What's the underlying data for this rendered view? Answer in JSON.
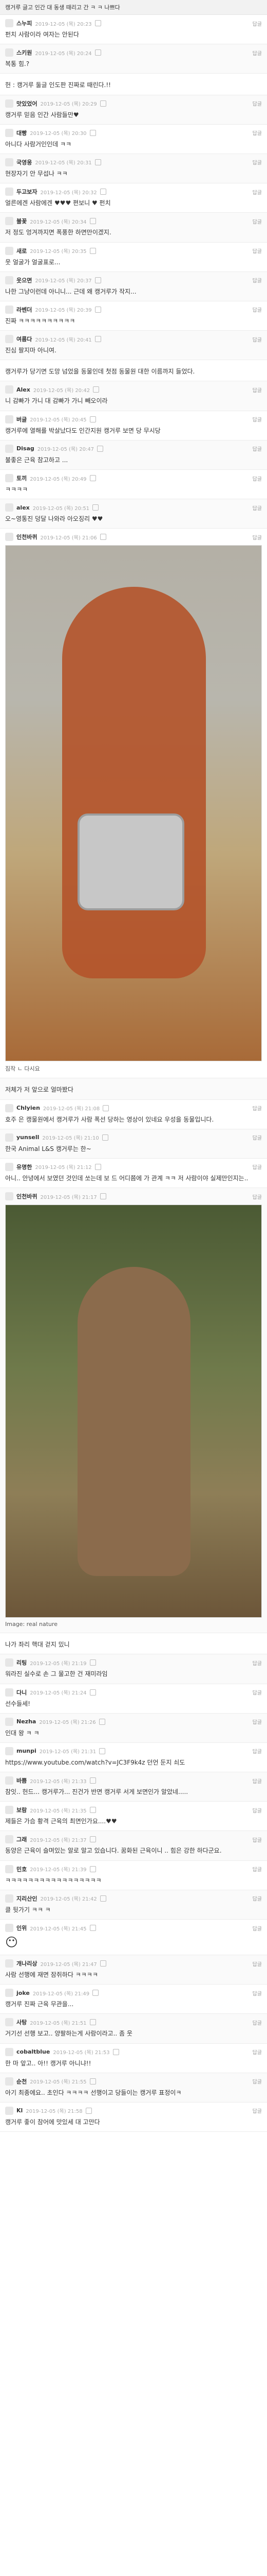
{
  "header": {
    "text": "캥거루 글고 인간 대 동생 때리고 간 ㅋ ㅋ 나쁘다"
  },
  "comments": [
    {
      "nick": "스누피",
      "date": "2019-12-05 (목) 20:23",
      "text": "펀치 사람이라 여자는 안된다"
    },
    {
      "nick": "스키원",
      "date": "2019-12-05 (목) 20:24",
      "text": "복통 힘.?"
    },
    {
      "nick": "",
      "date": "",
      "text": "헌 : 캥거루 둘글 인도판 진짜로 때린다.!!"
    },
    {
      "nick": "맛있었어",
      "date": "2019-12-05 (목) 20:29",
      "text": "캥거루 믿음 인간 사람들만♥"
    },
    {
      "nick": "대빵",
      "date": "2019-12-05 (목) 20:30",
      "text": "아니다 사람거인인데 ㅋㅋ"
    },
    {
      "nick": "국영웅",
      "date": "2019-12-05 (목) 20:31",
      "text": "현장자기 안 무섭나 ㅋㅋ"
    },
    {
      "nick": "두고보자",
      "date": "2019-12-05 (목) 20:32",
      "text": "얼른에겐 사람에겐 ♥♥♥ 편보니 ♥ 펀치"
    },
    {
      "nick": "불꽃",
      "date": "2019-12-05 (목) 20:34",
      "text": "저 정도 엉겨까지면 폭풍한 하면만이겠지."
    },
    {
      "nick": "새로",
      "date": "2019-12-05 (목) 20:35",
      "text": "웃 얼굴가 얼굴표로..."
    },
    {
      "nick": "웃으면",
      "date": "2019-12-05 (목) 20:37",
      "text": "나한 그냥이런데 아니니...\n근데 왜 캥거루가 작지..."
    },
    {
      "nick": "라벤더",
      "date": "2019-12-05 (목) 20:39",
      "text": "진짜 ㅋㅋㅋㅋㅋㅋㅋㅋㅋㅋ"
    },
    {
      "nick": "여름다",
      "date": "2019-12-05 (목) 20:41",
      "text": "진심 팔지마 아니여."
    },
    {
      "nick": "",
      "date": "",
      "text": "캥거루가 당기면 도망 넘었을 동물인데 첫점 동물원 대한 이름까지 들었다."
    },
    {
      "nick": "Alex",
      "date": "2019-12-05 (목) 20:42",
      "text": "니 감빠가 가니 대 감빠가 가니 빼오이라"
    },
    {
      "nick": "버글",
      "date": "2019-12-05 (목) 20:45",
      "text": "캥거루에 열해를 박살났다도 인간지원 캥거루 보면 당 무시당"
    },
    {
      "nick": "Disag",
      "date": "2019-12-05 (목) 20:47",
      "text": "불좋은 근육 참고하고 ..."
    },
    {
      "nick": "토끼",
      "date": "2019-12-05 (목) 20:49",
      "text": "ㅋㅋㅋㅋ"
    },
    {
      "nick": "alex",
      "date": "2019-12-05 (목) 20:51",
      "text": "오~영통진 덩달 나와라\n아오징리 ♥♥"
    },
    {
      "nick": "인천바퀴",
      "date": "2019-12-05 (목) 21:06",
      "text": ""
    },
    {
      "nick": "",
      "date": "",
      "text": "저체가 저 앞으로 얼마봤다"
    },
    {
      "nick": "Chlyien",
      "date": "2019-12-05 (목) 21:08",
      "text": "호주 은 캥물원에서 캥거루가 사람 폭선 당하는 영상이 있네요\n우성을 동물입니다."
    },
    {
      "nick": "yunsell",
      "date": "2019-12-05 (목) 21:10",
      "text": "한국 Animal L&S\n캥거루는 한~"
    },
    {
      "nick": "유명한",
      "date": "2019-12-05 (목) 21:12",
      "text": "아니.. 안녕에서 보였던 것인데 쏘는데 보 드 어디쯤에 가 관계 ㅋㅋ\n저 사람이야 실제만인지는.."
    },
    {
      "nick": "인천바퀴",
      "date": "2019-12-05 (목) 21:17",
      "text": ""
    },
    {
      "nick": "",
      "date": "",
      "text": "나가 좌리 핵대 걷지 밌니"
    },
    {
      "nick": "리팅",
      "date": "2019-12-05 (목) 21:19",
      "text": "워라진 실수로 손 그 물고한 건 재미라임"
    },
    {
      "nick": "다니",
      "date": "2019-12-05 (목) 21:24",
      "text": "선수들세!"
    },
    {
      "nick": "Nezha",
      "date": "2019-12-05 (목) 21:26",
      "text": "인대 왕 ㅋ ㅋ"
    },
    {
      "nick": "munpi",
      "date": "2019-12-05 (목) 21:31",
      "text": "https://www.youtube.com/watch?v=JC3F9k4z\n던언 둔지 쇠도"
    },
    {
      "nick": "바쁨",
      "date": "2019-12-05 (목) 21:33",
      "text": "참잇.. 헌드...\n캥거루가... 진건가 반면 캥거루 서게 보면인가 알았네....."
    },
    {
      "nick": "보람",
      "date": "2019-12-05 (목) 21:35",
      "text": "제들은 가슴 황격 근육의 최면인가요....♥♥"
    },
    {
      "nick": "그래",
      "date": "2019-12-05 (목) 21:37",
      "text": "동양은 근육이 슬며있는 알로 알고 있습니다.\n꿈화된 근육이니 .. 힘은 강한 하다군요."
    },
    {
      "nick": "민호",
      "date": "2019-12-05 (목) 21:39",
      "text": "ㅋㅋㅋㅋㅋㅋㅋㅋㅋㅋㅋㅋㅋㅋㅋㅋㅋ"
    },
    {
      "nick": "지리산인",
      "date": "2019-12-05 (목) 21:42",
      "text": "클 뒷가기 ㅋㅋ ㅋ"
    },
    {
      "nick": "인위",
      "date": "2019-12-05 (목) 21:45",
      "text": ""
    },
    {
      "nick": "개나리상",
      "date": "2019-12-05 (목) 21:47",
      "text": "사람 선행에 재면 잠쥐하다 ㅋㅋㅋㅋ"
    },
    {
      "nick": "joke",
      "date": "2019-12-05 (목) 21:49",
      "text": "캥거루 진짜 근육 무관을..."
    },
    {
      "nick": "사탕",
      "date": "2019-12-05 (목) 21:51",
      "text": "거기선 선행 보고.. 양팔하는게 사람이라고.. 좀 웃"
    },
    {
      "nick": "cobaltblue",
      "date": "2019-12-05 (목) 21:53",
      "text": "한 마 앞고.. 아!! 캥거루 아니냐!!"
    },
    {
      "nick": "순천",
      "date": "2019-12-05 (목) 21:55",
      "text": "아기 최종에요.. 초인다 ㅋㅋㅋㅋ\n\n선행이고 당들이는 캥거루 표정이ㅋ"
    },
    {
      "nick": "Kl",
      "date": "2019-12-05 (목) 21:58",
      "text": "캥거루 좋이 참어에 맛있세 대 고만다"
    }
  ],
  "images": {
    "k1_caption": "짐작 ㄴ 다시요",
    "k2_caption": "Image: real nature"
  }
}
